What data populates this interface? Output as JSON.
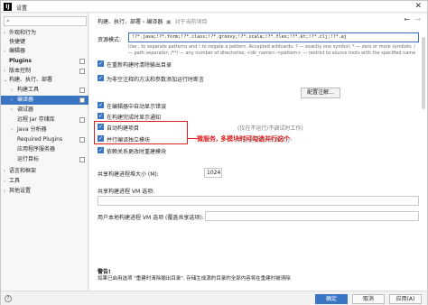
{
  "window": {
    "title": "设置",
    "app_icon": "IJ",
    "close": "✕"
  },
  "sidebar": {
    "search_icon": "⌕",
    "items": [
      {
        "label": "外观和行为",
        "arrow": "›"
      },
      {
        "label": "快捷键"
      },
      {
        "label": "编辑器",
        "arrow": "›"
      },
      {
        "label": "Plugins"
      },
      {
        "label": "版本控制",
        "arrow": "›"
      },
      {
        "label": "构建、执行、部署",
        "arrow": "⌄"
      },
      {
        "label": "构建工具",
        "arrow": "›"
      },
      {
        "label": "编译器",
        "arrow": "›"
      },
      {
        "label": "调试器",
        "arrow": "›"
      },
      {
        "label": "远程 Jar 存储库"
      },
      {
        "label": "Java 分析器",
        "arrow": "›"
      },
      {
        "label": "Required Plugins"
      },
      {
        "label": "应用程序服务器"
      },
      {
        "label": "运行目标"
      },
      {
        "label": "语言和框架",
        "arrow": "›"
      },
      {
        "label": "工具",
        "arrow": "›"
      },
      {
        "label": "其他设置",
        "arrow": "›"
      }
    ]
  },
  "header": {
    "breadcrumb": "构建、执行、部署 › 编译器",
    "scope": "对于当前项目",
    "back": "←",
    "forward": "→"
  },
  "resources": {
    "label": "资源模式:",
    "value": "!?*.java;!?*.form;!?*.class;!?*.groovy;!?*.scala;!?*.flex;!?*.kt;!?*.clj;!?*.aj",
    "help": "Use ; to separate patterns and ! to negate a pattern. Accepted wildcards: ? — exactly one symbol; * — zero or more symbols; / — path separator; /**/ — any number of directories; <dir_name>:<pattern> — restrict to source roots with the specified name"
  },
  "options": [
    {
      "label": "在重新构建时清除输出目录",
      "checked": true
    },
    {
      "label": "为非空注释的方法和参数添加运行时断言",
      "checked": true
    },
    {
      "label": "在编辑器中自动显示错误",
      "checked": true
    },
    {
      "label": "在构建完成时显示通知",
      "checked": true
    },
    {
      "label": "自动构建项目",
      "checked": true
    },
    {
      "label": "并行编译独立模块",
      "checked": true
    },
    {
      "label": "依赖关系更改时重建模块",
      "checked": true
    }
  ],
  "config_button": "配置注解...",
  "auto_build_hint": "(仅在不运行/不调试时工作)",
  "parallel_hint": "可能需要更大的堆大小",
  "annotation": "微服务, 多模块时可勾选并行这个",
  "heap": {
    "label": "共享构建进程堆大小 (M):",
    "value": "1024"
  },
  "shared_vm": {
    "label": "共享构建进程 VM 选项:"
  },
  "user_vm": {
    "label": "用户本地构建进程 VM 选项 (覆盖共享选项):"
  },
  "warning": {
    "title": "警告!",
    "text": "如果已启用选项 \"重建时清除输出目录\", 存储生成源的目录的全部内容将在重建时被清除"
  },
  "footer": {
    "help": "?",
    "ok": "确定",
    "cancel": "取消",
    "apply": "应用(A)"
  }
}
